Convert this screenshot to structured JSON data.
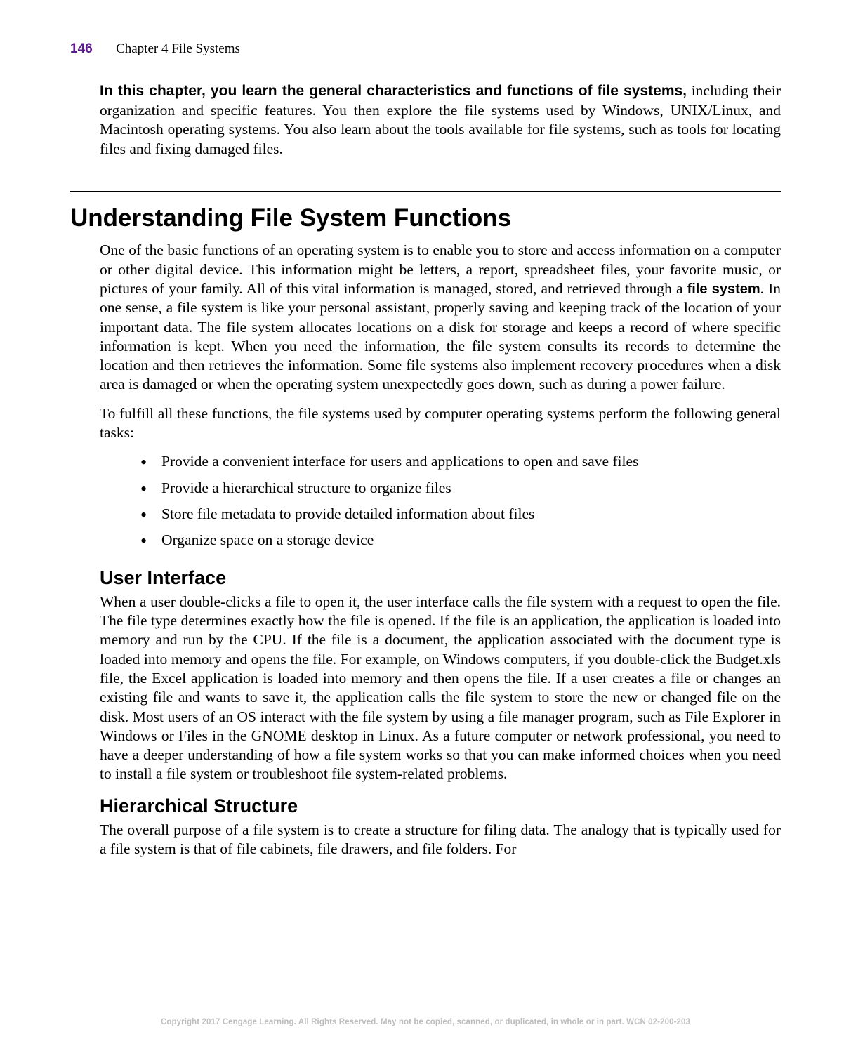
{
  "header": {
    "page_number": "146",
    "chapter_label": "Chapter 4   File Systems"
  },
  "intro": {
    "bold_lead": "In this chapter, you learn the general characteristics and functions of file systems,",
    "rest": " including their organization and specific features. You then explore the file systems used by Windows, UNIX/Linux, and Macintosh operating systems. You also learn about the tools available for file systems, such as tools for locating files and fixing damaged files."
  },
  "section": {
    "title": "Understanding File System Functions",
    "para1_a": "One of the basic functions of an operating system is to enable you to store and access information on a computer or other digital device. This information might be letters, a report, spreadsheet files, your favorite music, or pictures of your family. All of this vital information is managed, stored, and retrieved through a ",
    "term": "file system",
    "para1_b": ". In one sense, a file system is like your personal assistant, properly saving and keeping track of the location of your important data. The file system allocates locations on a disk for storage and keeps a record of where specific information is kept. When you need the information, the file system consults its records to determine the location and then retrieves the information. Some file systems also implement recovery procedures when a disk area is damaged or when the operating system unexpectedly goes down, such as during a power failure.",
    "para2": "To fulfill all these functions, the file systems used by computer operating systems perform the following general tasks:",
    "tasks": [
      "Provide a convenient interface for users and applications to open and save files",
      "Provide a hierarchical structure to organize files",
      "Store file metadata to provide detailed information about files",
      "Organize space on a storage device"
    ],
    "sub1_title": "User Interface",
    "sub1_para": "When a user double-clicks a file to open it, the user interface calls the file system with a request to open the file. The file type determines exactly how the file is opened. If the file is an application, the application is loaded into memory and run by the CPU. If the file is a document, the application associated with the document type is loaded into memory and opens the file. For example, on Windows computers, if you double-click the Budget.xls file, the Excel application is loaded into memory and then opens the file. If a user creates a file or changes an existing file and wants to save it, the application calls the file system to store the new or changed file on the disk. Most users of an OS interact with the file system by using a file manager program, such as File Explorer in Windows or Files in the GNOME desktop in Linux. As a future computer or network professional, you need to have a deeper understanding of how a file system works so that you can make informed choices when you need to install a file system or troubleshoot file system-related problems.",
    "sub2_title": "Hierarchical Structure",
    "sub2_para": "The overall purpose of a file system is to create a structure for filing data. The analogy that is typically used for a file system is that of file cabinets, file drawers, and file folders. For"
  },
  "footer": {
    "copyright": "Copyright 2017 Cengage Learning. All Rights Reserved. May not be copied, scanned, or duplicated, in whole or in part.  WCN 02-200-203"
  }
}
